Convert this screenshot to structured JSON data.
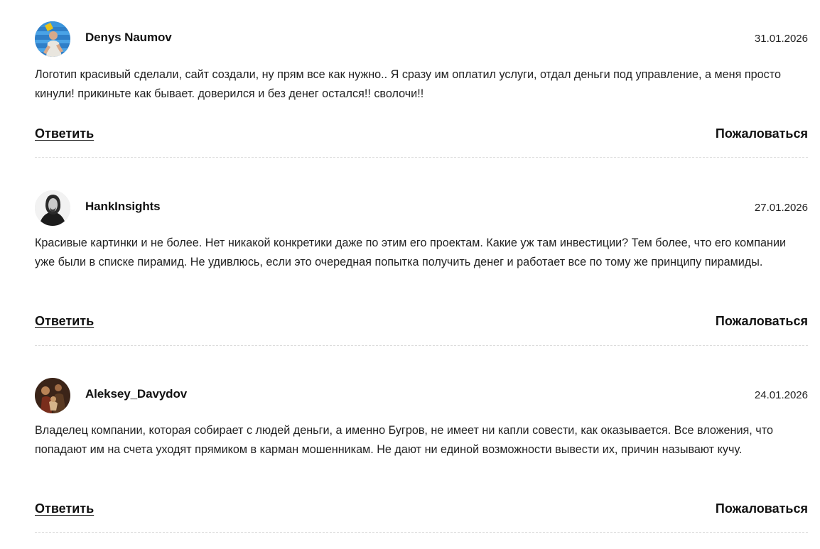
{
  "comments": [
    {
      "author": "Denys Naumov",
      "date": "31.01.2026",
      "avatar_icon": "user-photo-avatar-blue-background",
      "text": "Логотип красивый сделали, сайт создали, ну прям все как нужно.. Я сразу им оплатил услуги, отдал деньги под управление, а меня просто кинули! прикиньте как бывает. доверился и без денег остался!! сволочи!!",
      "reply_label": "Ответить",
      "report_label": "Пожаловаться"
    },
    {
      "author": "HankInsights",
      "date": "27.01.2026",
      "avatar_icon": "user-photo-avatar-monochrome",
      "text": "Красивые картинки и не более. Нет никакой конкретики даже по этим его проектам. Какие уж там инвестиции? Тем более, что его компании уже были в списке пирамид. Не удивлюсь, если это очередная попытка получить денег и работает все по тому же принципу пирамиды.",
      "reply_label": "Ответить",
      "report_label": "Пожаловаться"
    },
    {
      "author": "Aleksey_Davydov",
      "date": "24.01.2026",
      "avatar_icon": "user-painting-avatar-dark-brown",
      "text": "Владелец компании, которая собирает с людей деньги, а именно Бугров, не имеет ни капли совести, как оказывается. Все вложения, что попадают им на счета уходят прямиком в карман мошенникам. Не дают ни единой возможности вывести их, причин называют кучу.",
      "reply_label": "Ответить",
      "report_label": "Пожаловаться"
    }
  ]
}
